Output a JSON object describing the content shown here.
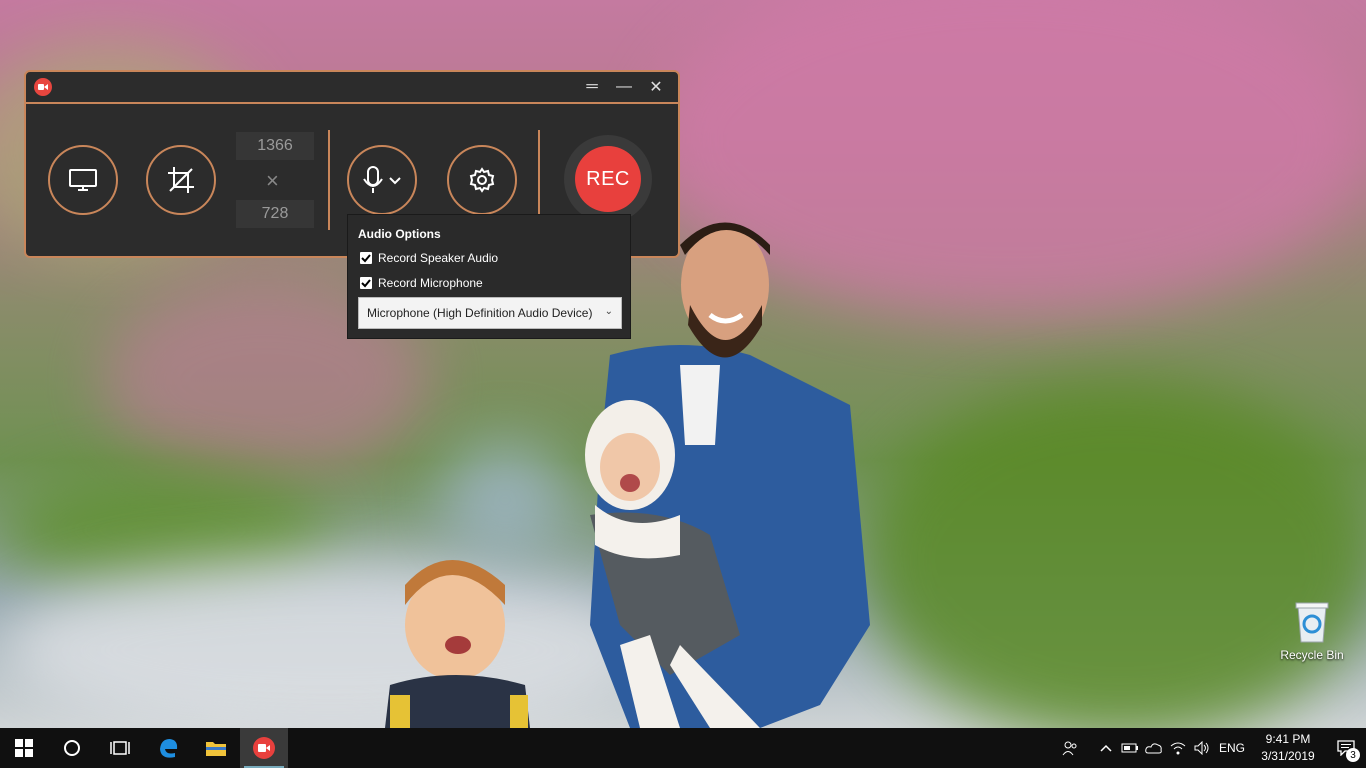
{
  "recorder": {
    "width_value": "1366",
    "height_value": "728",
    "times_glyph": "×",
    "rec_label": "REC",
    "window_controls": {
      "menu": "═",
      "minimize": "—",
      "close": "✕"
    }
  },
  "audio_options": {
    "title": "Audio Options",
    "speaker_label": "Record Speaker Audio",
    "speaker_checked": true,
    "mic_label": "Record Microphone",
    "mic_checked": true,
    "device_selected": "Microphone (High Definition Audio Device)"
  },
  "desktop": {
    "recycle_bin_label": "Recycle Bin"
  },
  "taskbar": {
    "items": [
      {
        "name": "start-button",
        "icon": "windows-logo-icon"
      },
      {
        "name": "cortana-button",
        "icon": "circle-icon"
      },
      {
        "name": "task-view-button",
        "icon": "task-view-icon"
      },
      {
        "name": "edge-button",
        "icon": "edge-icon"
      },
      {
        "name": "file-explorer-button",
        "icon": "folder-icon"
      },
      {
        "name": "recorder-app-button",
        "icon": "recorder-icon"
      }
    ],
    "language": "ENG",
    "time": "9:41 PM",
    "date": "3/31/2019",
    "notification_count": "3"
  },
  "colors": {
    "accent": "#c9865a",
    "rec": "#e8403d"
  }
}
